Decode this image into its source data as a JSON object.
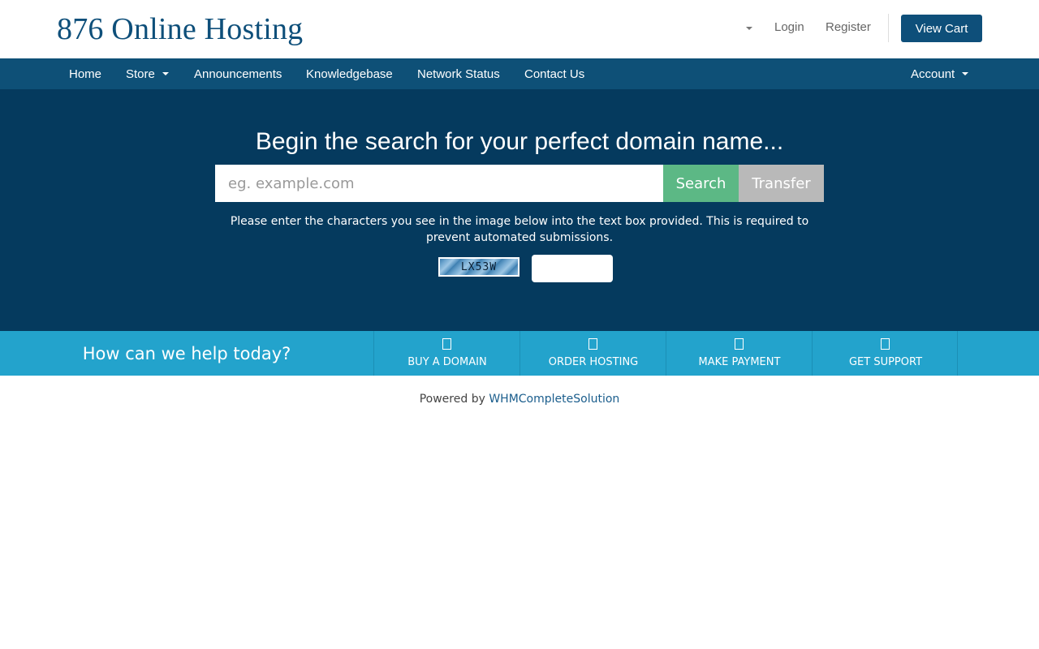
{
  "header": {
    "logo": "876 Online Hosting",
    "login_label": "Login",
    "register_label": "Register",
    "view_cart_label": "View Cart"
  },
  "nav": {
    "home": "Home",
    "store": "Store",
    "announcements": "Announcements",
    "knowledgebase": "Knowledgebase",
    "network_status": "Network Status",
    "contact_us": "Contact Us",
    "account": "Account"
  },
  "hero": {
    "title": "Begin the search for your perfect domain name...",
    "domain_placeholder": "eg. example.com",
    "search_label": "Search",
    "transfer_label": "Transfer",
    "captcha_instructions": "Please enter the characters you see in the image below into the text box provided. This is required to prevent automated submissions.",
    "captcha_code": "LX53W"
  },
  "help": {
    "title": "How can we help today?",
    "items": [
      {
        "label": "BUY A DOMAIN",
        "icon": "globe-icon"
      },
      {
        "label": "ORDER HOSTING",
        "icon": "server-icon"
      },
      {
        "label": "MAKE PAYMENT",
        "icon": "credit-card-icon"
      },
      {
        "label": "GET SUPPORT",
        "icon": "envelope-icon"
      }
    ]
  },
  "footer": {
    "powered_by": "Powered by",
    "link_text": "WHMCompleteSolution"
  },
  "colors": {
    "brand": "#0e4f7a",
    "nav_bg": "#0e5077",
    "hero_bg": "#053a5e",
    "search_button": "#5cb885",
    "transfer_button": "#b9b9b9",
    "help_bar": "#23a3cc"
  }
}
